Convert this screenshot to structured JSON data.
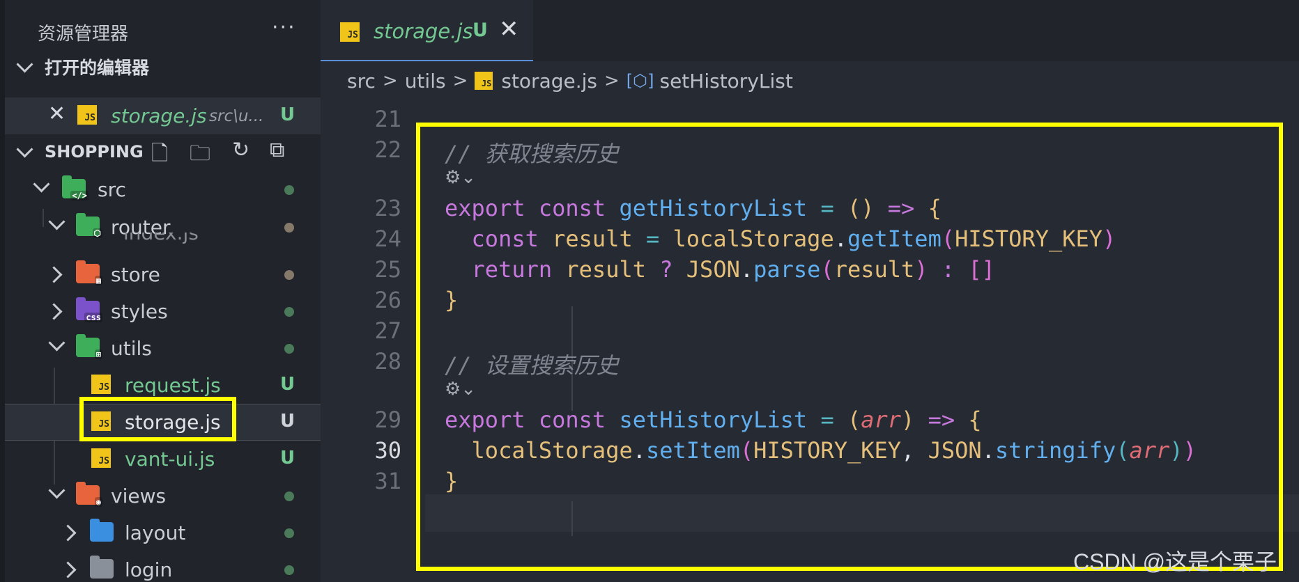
{
  "explorer": {
    "title": "资源管理器",
    "more": "···",
    "open_editors": {
      "label": "打开的编辑器",
      "file": "storage.js",
      "path": "src\\u...",
      "badge": "U"
    },
    "project": {
      "label": "SHOPPING",
      "tree": [
        {
          "label": "src",
          "status": "dot"
        },
        {
          "label": "router",
          "status": "dot"
        },
        {
          "label": "index.js",
          "status": "..."
        },
        {
          "label": "store",
          "status": "dot"
        },
        {
          "label": "styles",
          "status": "dot"
        },
        {
          "label": "utils",
          "status": "dot"
        },
        {
          "label": "request.js",
          "status": "U"
        },
        {
          "label": "storage.js",
          "status": "U"
        },
        {
          "label": "vant-ui.js",
          "status": "U"
        },
        {
          "label": "views",
          "status": "dot"
        },
        {
          "label": "layout",
          "status": "dot"
        },
        {
          "label": "login",
          "status": "dot"
        }
      ],
      "icon_labels": {
        "src": "</>",
        "router": "⬡",
        "store": "▦",
        "styles": "css",
        "utils": "⊞",
        "views": "◉",
        "js": "JS"
      }
    }
  },
  "tab": {
    "file": "storage.js",
    "badge": "U",
    "close": "✕"
  },
  "breadcrumb": [
    "src",
    "utils",
    "storage.js",
    "setHistoryList"
  ],
  "breadcrumb_sep": ">",
  "symbol_icon": "[⬡]",
  "code": {
    "line_numbers": [
      "21",
      "22",
      "23",
      "24",
      "25",
      "26",
      "27",
      "28",
      "29",
      "30",
      "31"
    ],
    "codelens": "⚙︎⌄",
    "l22": "// 获取搜索历史",
    "l28": "// 设置搜索历史",
    "t_export": "export",
    "t_const": "const",
    "t_return": "return",
    "t_get": "getHistoryList",
    "t_set": "setHistoryList",
    "t_eq": "=",
    "t_arrow": "=>",
    "t_lp": "(",
    "t_rp": ")",
    "t_lb": "{",
    "t_rb": "}",
    "t_result": "result",
    "t_localStorage": "localStorage",
    "t_dot": ".",
    "t_getItem": "getItem",
    "t_setItem": "setItem",
    "t_key": "HISTORY_KEY",
    "t_comma": ",",
    "t_q": "?",
    "t_colon": ":",
    "t_JSON": "JSON",
    "t_parse": "parse",
    "t_stringify": "stringify",
    "t_arr": "arr",
    "t_emptyarr": "[]"
  },
  "watermark": "CSDN @这是个栗子",
  "colors": {
    "highlight": "#ffff00",
    "untracked": "#73c991",
    "js": "#f0c419"
  }
}
